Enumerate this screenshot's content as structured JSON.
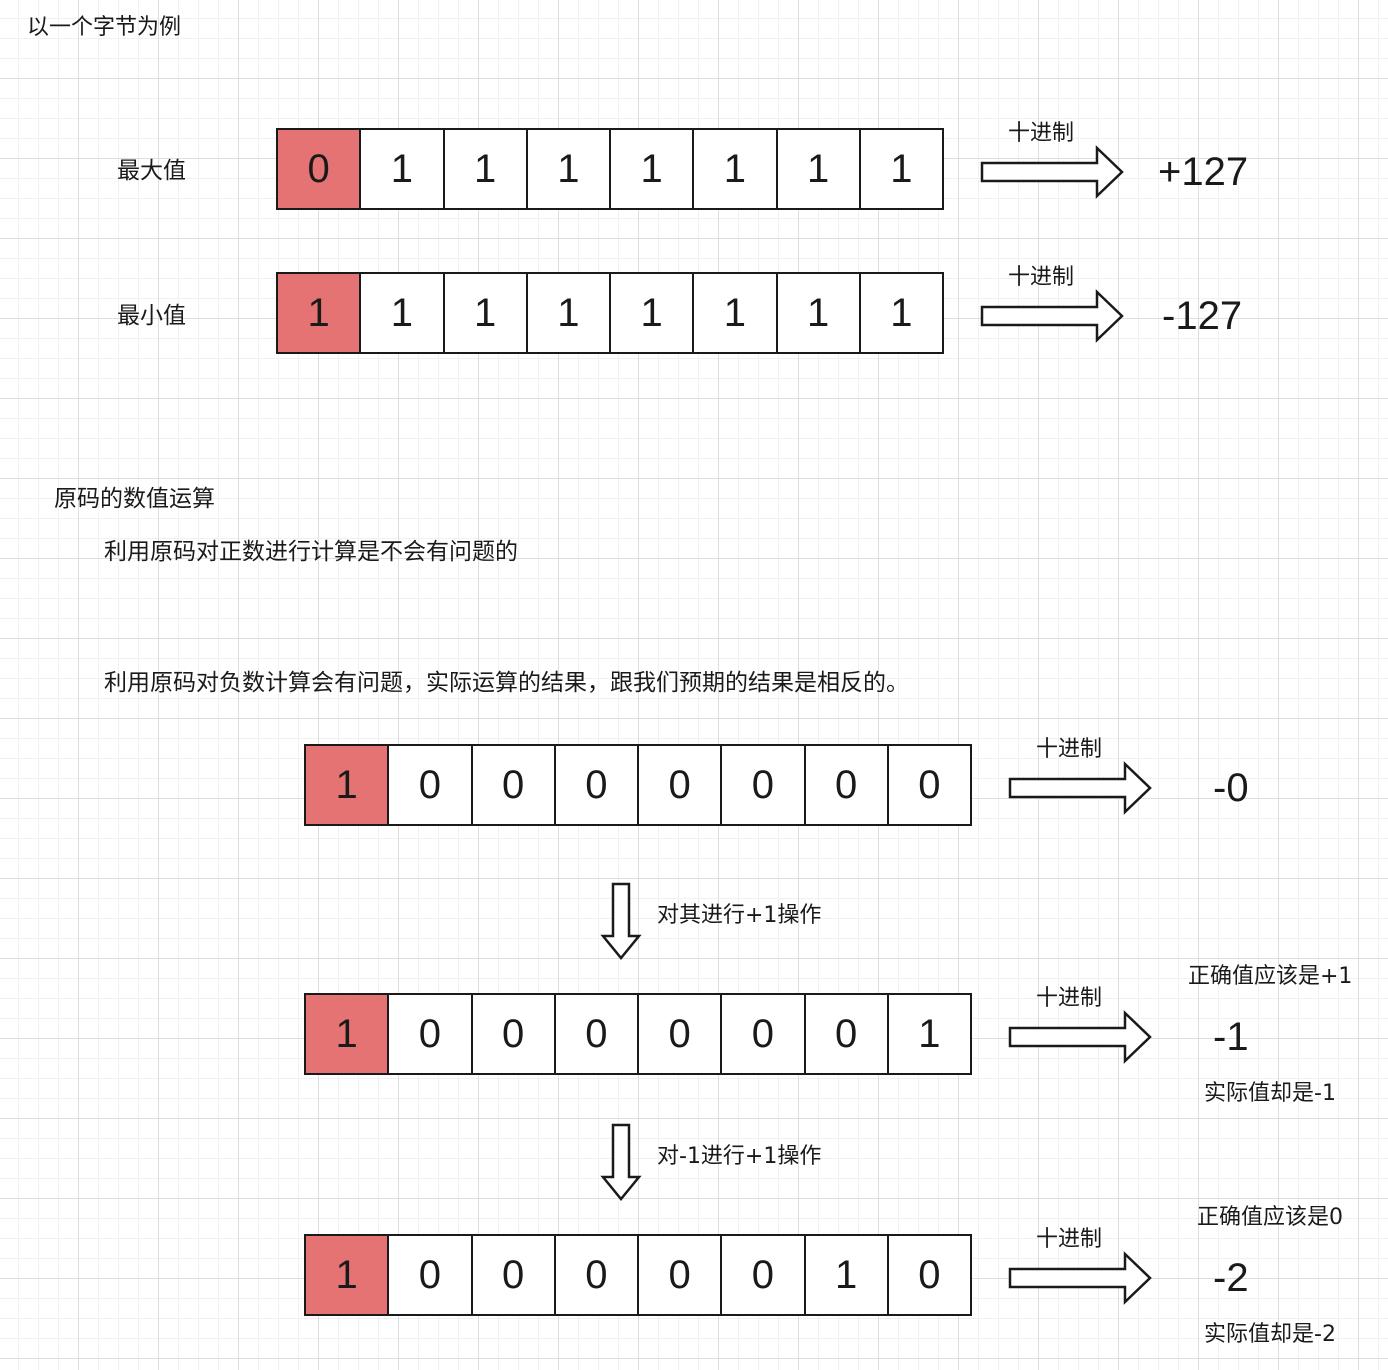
{
  "heading": "以一个字节为例",
  "decimal_label": "十进制",
  "section_title": "原码的数值运算",
  "note_positive": "利用原码对正数进行计算是不会有问题的",
  "note_negative": "利用原码对负数计算会有问题，实际运算的结果，跟我们预期的结果是相反的。",
  "rows": [
    {
      "label": "最大值",
      "bits": [
        "0",
        "1",
        "1",
        "1",
        "1",
        "1",
        "1",
        "1"
      ],
      "result": "+127"
    },
    {
      "label": "最小值",
      "bits": [
        "1",
        "1",
        "1",
        "1",
        "1",
        "1",
        "1",
        "1"
      ],
      "result": "-127"
    },
    {
      "bits": [
        "1",
        "0",
        "0",
        "0",
        "0",
        "0",
        "0",
        "0"
      ],
      "result": "-0"
    },
    {
      "bits": [
        "1",
        "0",
        "0",
        "0",
        "0",
        "0",
        "0",
        "1"
      ],
      "result": "-1",
      "expected": "正确值应该是+1",
      "actual": "实际值却是-1"
    },
    {
      "bits": [
        "1",
        "0",
        "0",
        "0",
        "0",
        "0",
        "1",
        "0"
      ],
      "result": "-2",
      "expected": "正确值应该是0",
      "actual": "实际值却是-2"
    }
  ],
  "steps": [
    "对其进行+1操作",
    "对-1进行+1操作"
  ],
  "colors": {
    "sign_bit": "#e57373",
    "stroke": "#1a1a1a"
  }
}
